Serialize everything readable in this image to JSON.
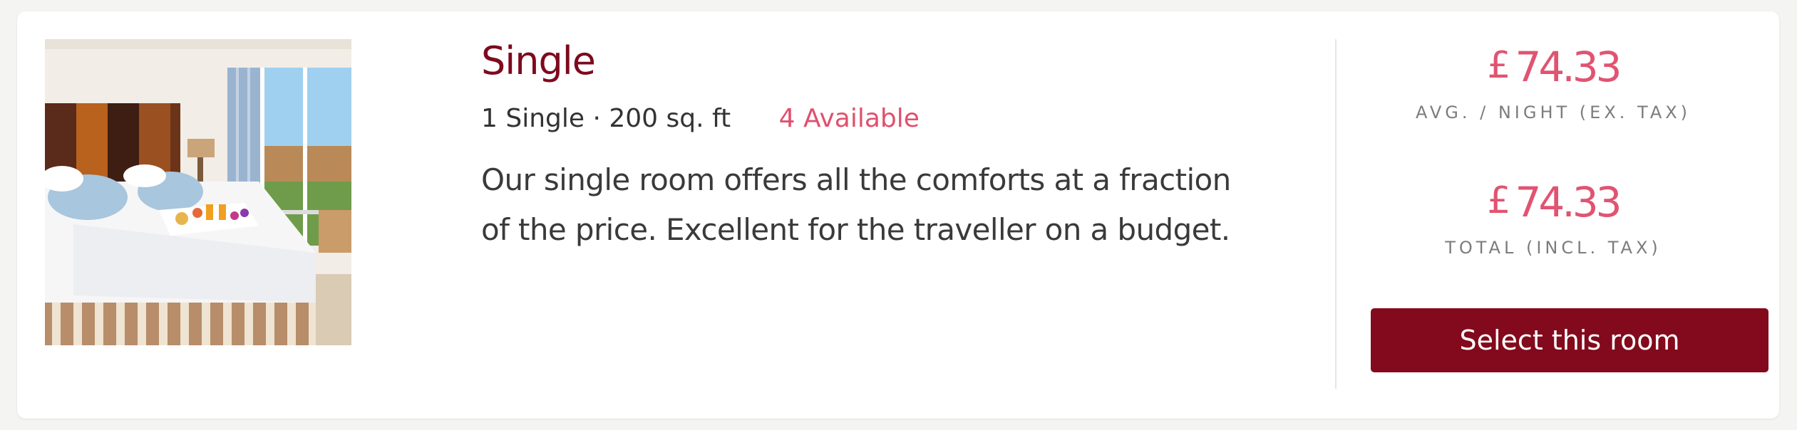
{
  "room": {
    "name": "Single",
    "details": "1 Single · 200 sq. ft",
    "availability": "4 Available",
    "description": "Our single room offers all the comforts at a fraction of the price. Excellent for the traveller on a budget.",
    "image": "hotel-room-photo"
  },
  "pricing": {
    "currency": "£",
    "avg_night": {
      "amount": "74.33",
      "label": "AVG. / NIGHT (EX. TAX)"
    },
    "total": {
      "amount": "74.33",
      "label": "TOTAL (INCL. TAX)"
    }
  },
  "actions": {
    "select_label": "Select this room"
  },
  "colors": {
    "brand": "#820a1c",
    "title": "#7d0a1e",
    "price": "#e05471",
    "availability": "#e0506e"
  }
}
